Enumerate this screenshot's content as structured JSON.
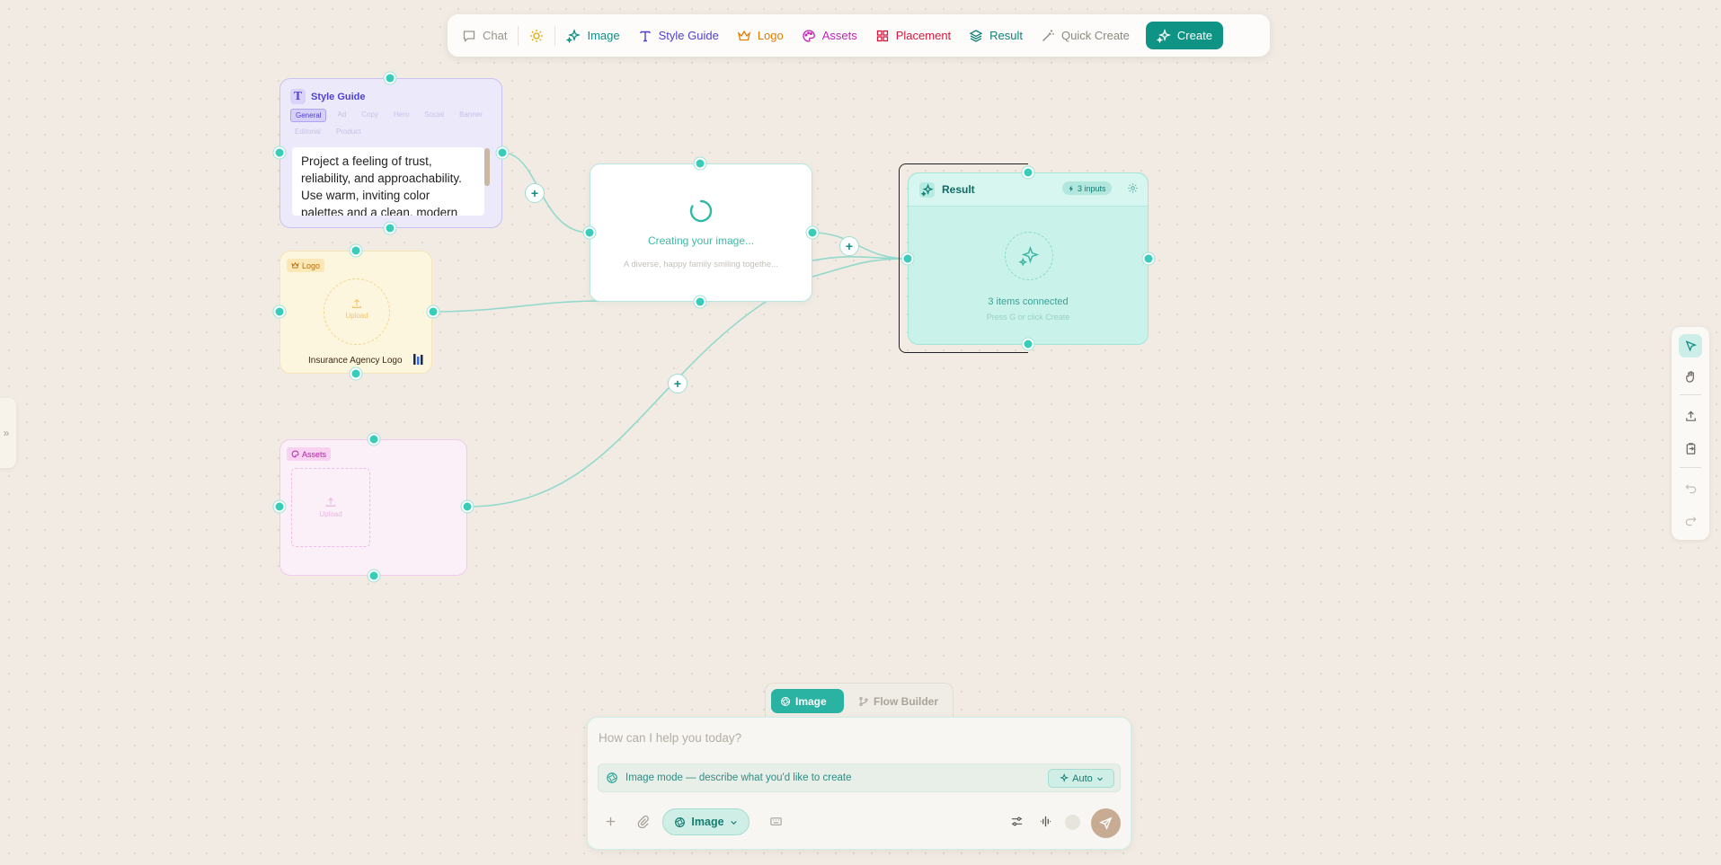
{
  "toolbar": {
    "chat": "Chat",
    "image": "Image",
    "style_guide": "Style Guide",
    "logo": "Logo",
    "assets": "Assets",
    "placement": "Placement",
    "result": "Result",
    "quick_create": "Quick Create",
    "create": "Create"
  },
  "nodes": {
    "style_guide": {
      "title": "Style Guide",
      "tabs": [
        "General",
        "Ad",
        "Copy",
        "Hero",
        "Social",
        "Banner",
        "Editorial",
        "Product"
      ],
      "active_tab": "General",
      "text": "Project a feeling of trust, reliability, and approachability. Use warm, inviting color palettes and a clean, modern"
    },
    "logo": {
      "badge": "Logo",
      "upload": "Upload",
      "caption": "Insurance Agency Logo"
    },
    "assets": {
      "badge": "Assets",
      "upload": "Upload"
    },
    "creating": {
      "status": "Creating your image...",
      "prompt": "A diverse, happy family smiling togethe..."
    },
    "result": {
      "title": "Result",
      "inputs": "3 inputs",
      "connected": "3 items connected",
      "hint": "Press G or click Create"
    }
  },
  "mode_switch": {
    "image": "Image",
    "flow": "Flow Builder"
  },
  "chat": {
    "placeholder": "How can I help you today?",
    "mode_hint": "Image mode — describe what you'd like to create",
    "auto": "Auto",
    "mode_select": "Image"
  },
  "colors": {
    "accent": "#0f9384",
    "handle": "#38cdb8",
    "canvas": "#f1ebe3"
  },
  "icons": [
    "chat-icon",
    "sun-icon",
    "sparkles-icon",
    "type-icon",
    "crown-icon",
    "palette-icon",
    "grid-icon",
    "layers-icon",
    "wand-icon",
    "cursor-icon",
    "hand-icon",
    "upload-icon",
    "clipboard-icon",
    "undo-icon",
    "redo-icon",
    "send-icon"
  ]
}
